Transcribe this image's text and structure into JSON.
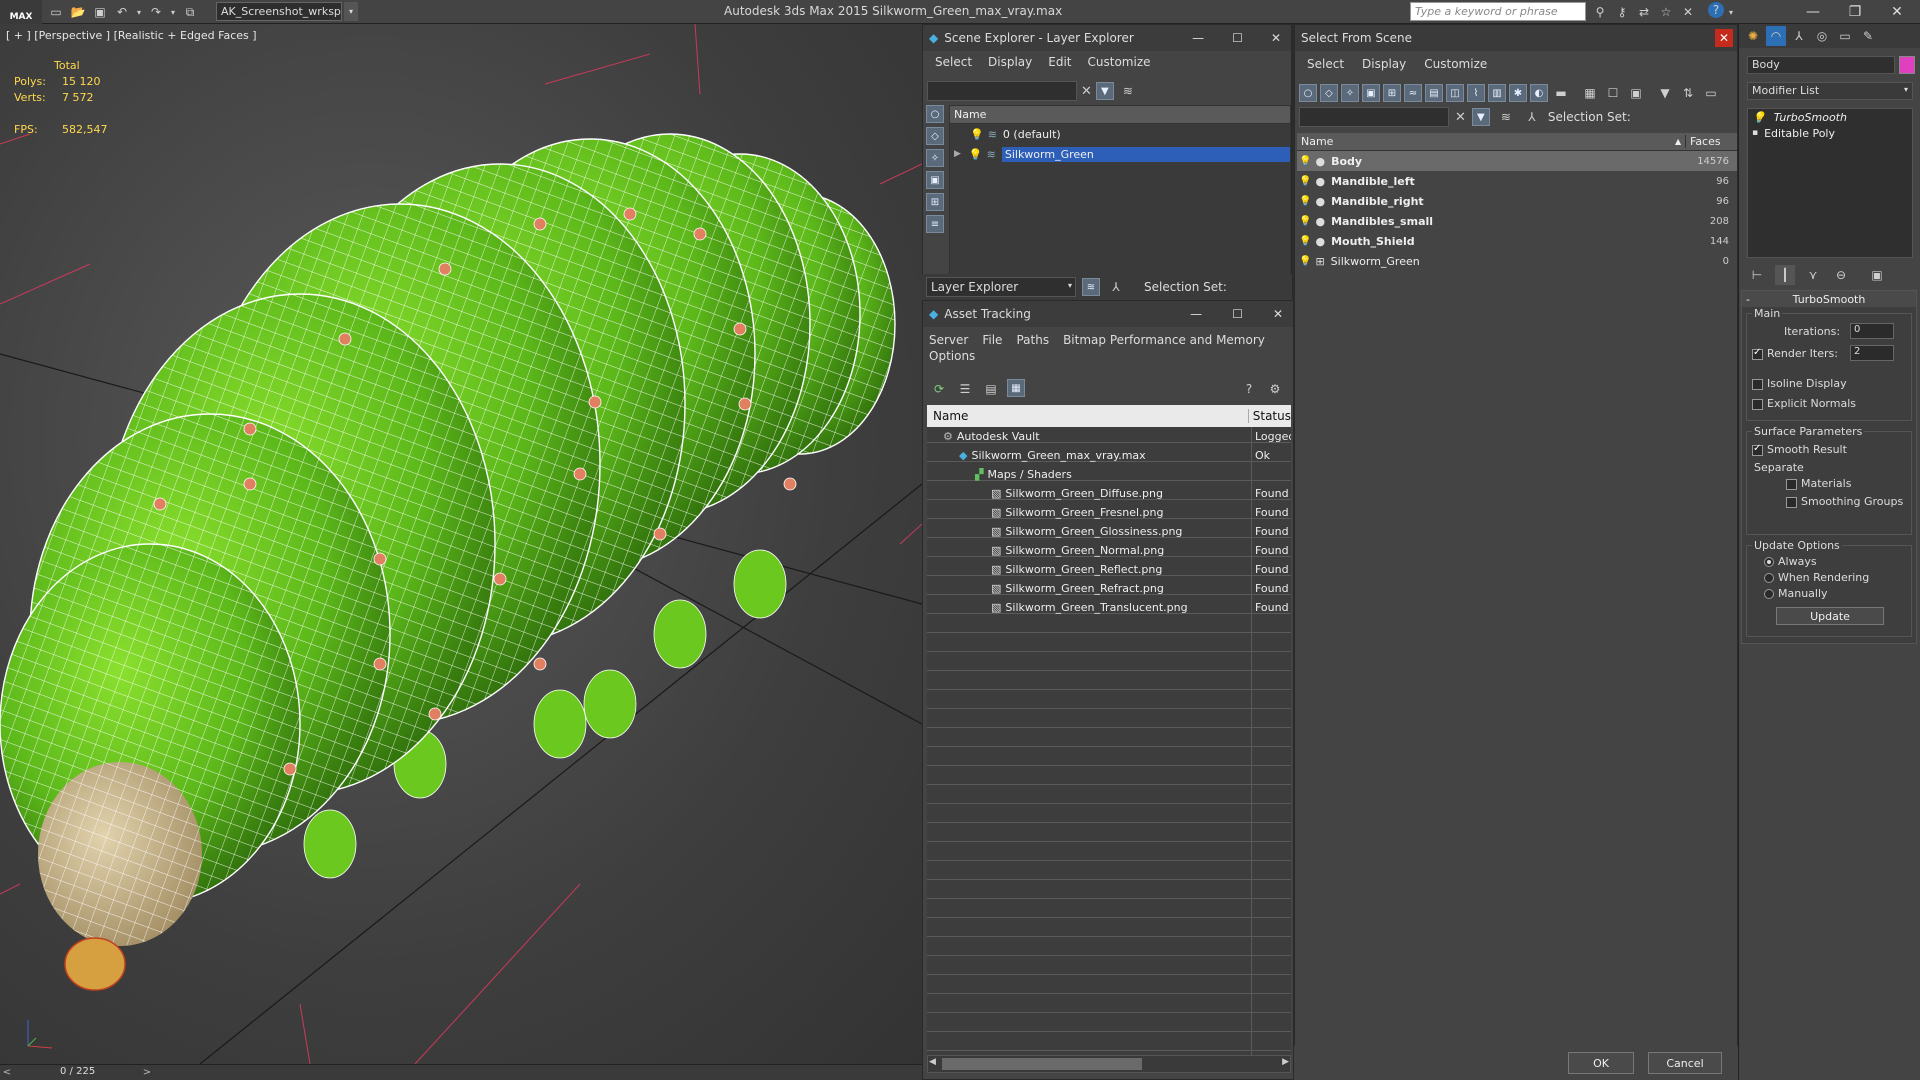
{
  "topbar": {
    "logo": "MAX",
    "workspace": "AK_Screenshot_wrksp",
    "app_title": "Autodesk 3ds Max  2015    Silkworm_Green_max_vray.max",
    "search_placeholder": "Type a keyword or phrase"
  },
  "viewport": {
    "label": "[ + ] [Perspective ] [Realistic + Edged Faces ]",
    "stats": {
      "total_label": "Total",
      "polys_label": "Polys:",
      "polys_value": "15 120",
      "verts_label": "Verts:",
      "verts_value": "7 572",
      "fps_label": "FPS:",
      "fps_value": "582,547"
    },
    "timeline": "0 / 225",
    "colors": {
      "body": "#6bc81e",
      "wire": "#ffffff",
      "head": "#cdbb95",
      "grid": "#1a1a1a",
      "accent": "#c83a5a"
    }
  },
  "scene_explorer": {
    "title": "Scene Explorer - Layer Explorer",
    "menu": [
      "Select",
      "Display",
      "Edit",
      "Customize"
    ],
    "column": "Name",
    "rows": [
      {
        "name": "0 (default)",
        "selected": false
      },
      {
        "name": "Silkworm_Green",
        "selected": true
      }
    ],
    "footer_combo": "Layer Explorer",
    "selection_set": "Selection Set:"
  },
  "asset_tracking": {
    "title": "Asset Tracking",
    "menu": [
      "Server",
      "File",
      "Paths",
      "Bitmap Performance and Memory"
    ],
    "menu2": "Options",
    "columns": {
      "name": "Name",
      "status": "Status"
    },
    "rows": [
      {
        "name": "Autodesk Vault",
        "status": "Logged",
        "indent": 1
      },
      {
        "name": "Silkworm_Green_max_vray.max",
        "status": "Ok",
        "indent": 2
      },
      {
        "name": "Maps / Shaders",
        "status": "",
        "indent": 3
      },
      {
        "name": "Silkworm_Green_Diffuse.png",
        "status": "Found",
        "indent": 4
      },
      {
        "name": "Silkworm_Green_Fresnel.png",
        "status": "Found",
        "indent": 4
      },
      {
        "name": "Silkworm_Green_Glossiness.png",
        "status": "Found",
        "indent": 4
      },
      {
        "name": "Silkworm_Green_Normal.png",
        "status": "Found",
        "indent": 4
      },
      {
        "name": "Silkworm_Green_Reflect.png",
        "status": "Found",
        "indent": 4
      },
      {
        "name": "Silkworm_Green_Refract.png",
        "status": "Found",
        "indent": 4
      },
      {
        "name": "Silkworm_Green_Translucent.png",
        "status": "Found",
        "indent": 4
      }
    ]
  },
  "select_from_scene": {
    "title": "Select From Scene",
    "menu": [
      "Select",
      "Display",
      "Customize"
    ],
    "selection_set": "Selection Set:",
    "columns": {
      "name": "Name",
      "faces": "Faces"
    },
    "rows": [
      {
        "name": "Body",
        "faces": "14576",
        "bold": true,
        "selected": true
      },
      {
        "name": "Mandible_left",
        "faces": "96",
        "bold": true,
        "selected": false
      },
      {
        "name": "Mandible_right",
        "faces": "96",
        "bold": true,
        "selected": false
      },
      {
        "name": "Mandibles_small",
        "faces": "208",
        "bold": true,
        "selected": false
      },
      {
        "name": "Mouth_Shield",
        "faces": "144",
        "bold": true,
        "selected": false
      },
      {
        "name": "Silkworm_Green",
        "faces": "0",
        "bold": false,
        "selected": false
      }
    ],
    "ok": "OK",
    "cancel": "Cancel"
  },
  "command_panel": {
    "object_name": "Body",
    "modifier_list": "Modifier List",
    "stack": [
      "TurboSmooth",
      "Editable Poly"
    ],
    "turbosmooth": {
      "title": "TurboSmooth",
      "main": "Main",
      "iterations_label": "Iterations:",
      "iterations_value": "0",
      "render_iters_label": "Render Iters:",
      "render_iters_value": "2",
      "isoline": "Isoline Display",
      "explicit_normals": "Explicit Normals",
      "surface_params": "Surface Parameters",
      "smooth_result": "Smooth Result",
      "separate": "Separate",
      "materials": "Materials",
      "smoothing_groups": "Smoothing Groups",
      "update_options": "Update Options",
      "always": "Always",
      "when_rendering": "When Rendering",
      "manually": "Manually",
      "update_btn": "Update"
    }
  }
}
